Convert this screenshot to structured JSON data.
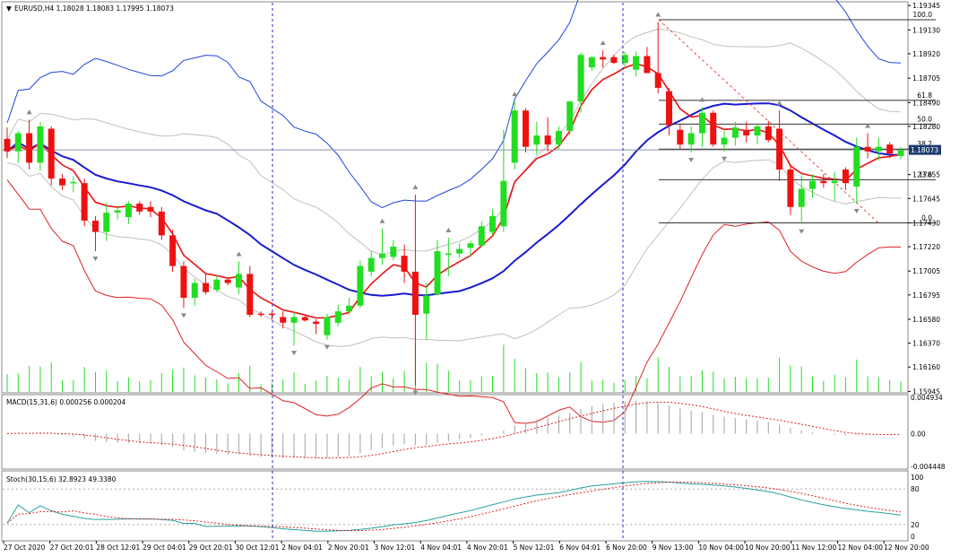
{
  "colors": {
    "bull": "#22dd22",
    "bear": "#ee1111",
    "ema_fast": "#ee1111",
    "ma_mid": "#1a1ad0",
    "band_outer_upper": "#2244dd",
    "band_outer_lower": "#dd2222",
    "band_inner": "#c0c0c0",
    "fibo": "#333333",
    "trend": "#ee4444",
    "current_price_bg": "#1f3b6e",
    "macd_hist": "#b0b0b0",
    "stoch_main": "#2aa0a0",
    "stoch_signal": "#dd2222"
  },
  "chart_data": {
    "type": "candlestick",
    "title": "EURUSD,H4  1.18028 1.18083 1.17995 1.18073",
    "symbol": "EURUSD,H4",
    "current_price": "1.18073",
    "ylim": [
      1.1594,
      1.1937
    ],
    "price_ticks": [
      "1.19345",
      "1.19130",
      "1.18920",
      "1.18705",
      "1.18490",
      "1.18280",
      "1.17855",
      "1.17645",
      "1.17430",
      "1.17220",
      "1.17005",
      "1.16795",
      "1.16580",
      "1.16370",
      "1.16160",
      "1.15945"
    ],
    "x_labels": [
      "27 Oct 2020",
      "27 Oct 20:01",
      "28 Oct 12:01",
      "29 Oct 04:01",
      "29 Oct 20:01",
      "30 Oct 12:01",
      "2 Nov 04:01",
      "2 Nov 20:01",
      "3 Nov 12:01",
      "4 Nov 04:01",
      "4 Nov 20:01",
      "5 Nov 12:01",
      "6 Nov 04:01",
      "6 Nov 20:00",
      "9 Nov 13:00",
      "10 Nov 04:00",
      "10 Nov 20:00",
      "11 Nov 12:00",
      "12 Nov 04:00",
      "12 Nov 20:00"
    ],
    "candles": [
      [
        1.1817,
        1.1827,
        1.18,
        1.1806
      ],
      [
        1.1806,
        1.1824,
        1.1796,
        1.1822
      ],
      [
        1.1822,
        1.1834,
        1.179,
        1.1796
      ],
      [
        1.1796,
        1.1832,
        1.1789,
        1.1828
      ],
      [
        1.1826,
        1.1828,
        1.1776,
        1.1782
      ],
      [
        1.1782,
        1.1786,
        1.1772,
        1.1776
      ],
      [
        1.1778,
        1.1784,
        1.177,
        1.1779
      ],
      [
        1.1778,
        1.1782,
        1.174,
        1.1745
      ],
      [
        1.1745,
        1.1749,
        1.1718,
        1.1735
      ],
      [
        1.1735,
        1.1761,
        1.1727,
        1.1752
      ],
      [
        1.1752,
        1.1758,
        1.1746,
        1.1754
      ],
      [
        1.1748,
        1.1762,
        1.1742,
        1.176
      ],
      [
        1.176,
        1.1762,
        1.175,
        1.1753
      ],
      [
        1.1757,
        1.1762,
        1.1748,
        1.1753
      ],
      [
        1.1753,
        1.1757,
        1.1728,
        1.1732
      ],
      [
        1.1732,
        1.1737,
        1.17,
        1.1705
      ],
      [
        1.1705,
        1.1709,
        1.1668,
        1.1677
      ],
      [
        1.1677,
        1.1694,
        1.167,
        1.169
      ],
      [
        1.169,
        1.1699,
        1.168,
        1.1682
      ],
      [
        1.1684,
        1.1697,
        1.1682,
        1.1693
      ],
      [
        1.1693,
        1.1695,
        1.1688,
        1.169
      ],
      [
        1.1686,
        1.1709,
        1.168,
        1.1698
      ],
      [
        1.1698,
        1.1705,
        1.166,
        1.1662
      ],
      [
        1.1663,
        1.1665,
        1.166,
        1.1662
      ],
      [
        1.1663,
        1.1665,
        1.1658,
        1.1662
      ],
      [
        1.166,
        1.1665,
        1.165,
        1.1655
      ],
      [
        1.1655,
        1.1665,
        1.1635,
        1.166
      ],
      [
        1.166,
        1.1662,
        1.1656,
        1.1657
      ],
      [
        1.1656,
        1.1658,
        1.1645,
        1.1654
      ],
      [
        1.1644,
        1.1663,
        1.164,
        1.166
      ],
      [
        1.1655,
        1.1671,
        1.1652,
        1.1665
      ],
      [
        1.1665,
        1.1677,
        1.1662,
        1.167
      ],
      [
        1.167,
        1.171,
        1.1668,
        1.1705
      ],
      [
        1.17,
        1.1718,
        1.1696,
        1.1712
      ],
      [
        1.1712,
        1.1738,
        1.1706,
        1.1716
      ],
      [
        1.1713,
        1.1728,
        1.171,
        1.1722
      ],
      [
        1.1714,
        1.1724,
        1.169,
        1.17
      ],
      [
        1.17,
        1.1768,
        1.16,
        1.1662
      ],
      [
        1.1663,
        1.169,
        1.164,
        1.1679
      ],
      [
        1.168,
        1.1728,
        1.1679,
        1.1718
      ],
      [
        1.1715,
        1.173,
        1.1696,
        1.1716
      ],
      [
        1.1716,
        1.1725,
        1.1712,
        1.172
      ],
      [
        1.1721,
        1.1727,
        1.1713,
        1.1725
      ],
      [
        1.1723,
        1.1744,
        1.1722,
        1.174
      ],
      [
        1.1735,
        1.1755,
        1.1732,
        1.1749
      ],
      [
        1.174,
        1.1825,
        1.1735,
        1.178
      ],
      [
        1.1796,
        1.185,
        1.179,
        1.1842
      ],
      [
        1.1842,
        1.1844,
        1.1805,
        1.181
      ],
      [
        1.1812,
        1.1832,
        1.1803,
        1.182
      ],
      [
        1.182,
        1.1836,
        1.1806,
        1.1812
      ],
      [
        1.1812,
        1.1828,
        1.1808,
        1.1824
      ],
      [
        1.1824,
        1.185,
        1.182,
        1.185
      ],
      [
        1.185,
        1.1893,
        1.184,
        1.1891
      ],
      [
        1.188,
        1.189,
        1.1877,
        1.1889
      ],
      [
        1.1889,
        1.1895,
        1.188,
        1.1887
      ],
      [
        1.1889,
        1.1891,
        1.1883,
        1.1884
      ],
      [
        1.1884,
        1.1894,
        1.188,
        1.1891
      ],
      [
        1.1878,
        1.1894,
        1.1872,
        1.189
      ],
      [
        1.189,
        1.1898,
        1.188,
        1.1875
      ],
      [
        1.1875,
        1.192,
        1.1857,
        1.1862
      ],
      [
        1.1859,
        1.1862,
        1.182,
        1.1829
      ],
      [
        1.1825,
        1.183,
        1.1808,
        1.1812
      ],
      [
        1.1812,
        1.1828,
        1.1805,
        1.1822
      ],
      [
        1.1822,
        1.1845,
        1.181,
        1.184
      ],
      [
        1.184,
        1.1842,
        1.181,
        1.1812
      ],
      [
        1.1812,
        1.1824,
        1.1806,
        1.1818
      ],
      [
        1.1818,
        1.1832,
        1.1811,
        1.1827
      ],
      [
        1.1825,
        1.1832,
        1.1814,
        1.182
      ],
      [
        1.182,
        1.183,
        1.1812,
        1.1828
      ],
      [
        1.1828,
        1.1833,
        1.1814,
        1.1816
      ],
      [
        1.1826,
        1.1842,
        1.178,
        1.179
      ],
      [
        1.179,
        1.1795,
        1.175,
        1.1757
      ],
      [
        1.1757,
        1.1785,
        1.1742,
        1.1773
      ],
      [
        1.1773,
        1.1786,
        1.1765,
        1.178
      ],
      [
        1.178,
        1.1786,
        1.1774,
        1.1778
      ],
      [
        1.1778,
        1.1788,
        1.1762,
        1.178
      ],
      [
        1.179,
        1.1792,
        1.1772,
        1.1778
      ],
      [
        1.1775,
        1.1818,
        1.176,
        1.181
      ],
      [
        1.181,
        1.1822,
        1.18,
        1.1806
      ],
      [
        1.1806,
        1.1818,
        1.1798,
        1.181
      ],
      [
        1.1812,
        1.1814,
        1.18,
        1.1804
      ],
      [
        1.1802,
        1.181,
        1.1799,
        1.1807
      ]
    ],
    "fibo_levels": [
      {
        "label": "100.0",
        "value": 1.1922
      },
      {
        "label": "61.8",
        "value": 1.1851
      },
      {
        "label": "50.0",
        "value": 1.183
      },
      {
        "label": "38.2",
        "value": 1.1808
      },
      {
        "label": "23.6",
        "value": 1.1781
      },
      {
        "label": "0.0",
        "value": 1.1743
      }
    ],
    "macd": {
      "label": "MACD(15,31,6) 0.000256 0.000204",
      "ticks": [
        "0.004934",
        "0.00",
        "-0.004448"
      ],
      "ylim": [
        -0.004448,
        0.004934
      ]
    },
    "stoch": {
      "label": "Stoch(30,15,6) 32.8923 49.3380",
      "ticks": [
        "100",
        "80",
        "20",
        "0"
      ],
      "ylim": [
        0,
        100
      ],
      "levels": [
        80,
        20
      ]
    },
    "grid": false
  }
}
